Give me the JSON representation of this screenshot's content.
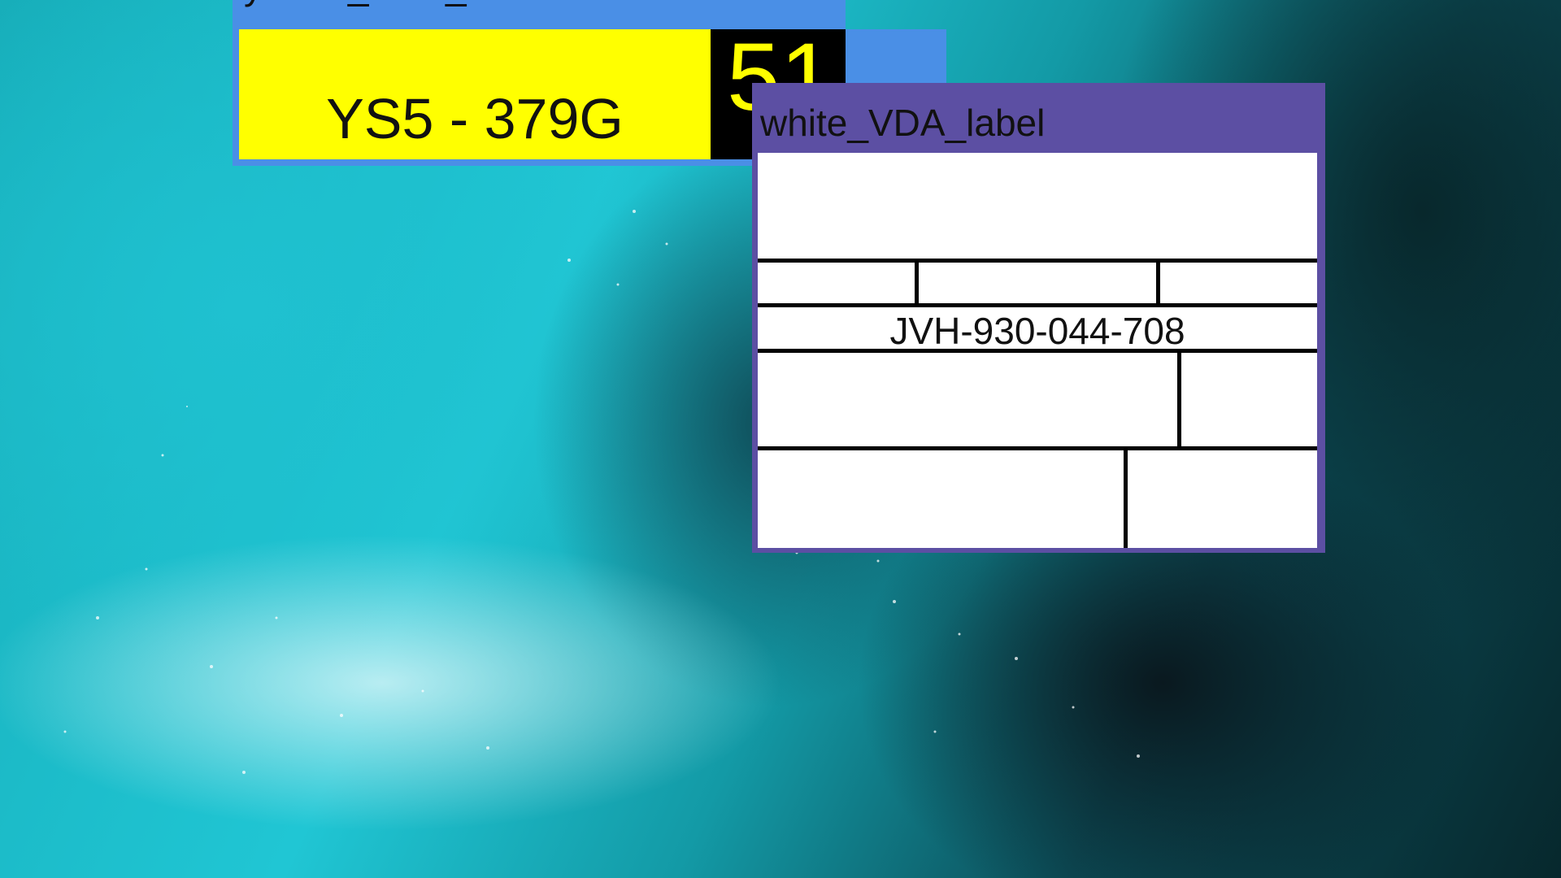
{
  "yellow_window": {
    "title": "yellow_VDA_label",
    "plate_text": "YS5 - 379G",
    "number": "51"
  },
  "white_window": {
    "title": "white_VDA_label",
    "serial": "JVH-930-044-708"
  },
  "colors": {
    "yellow_titlebar": "#4a8fe6",
    "white_titlebar": "#5c4fa3",
    "label_yellow": "#ffff00"
  }
}
